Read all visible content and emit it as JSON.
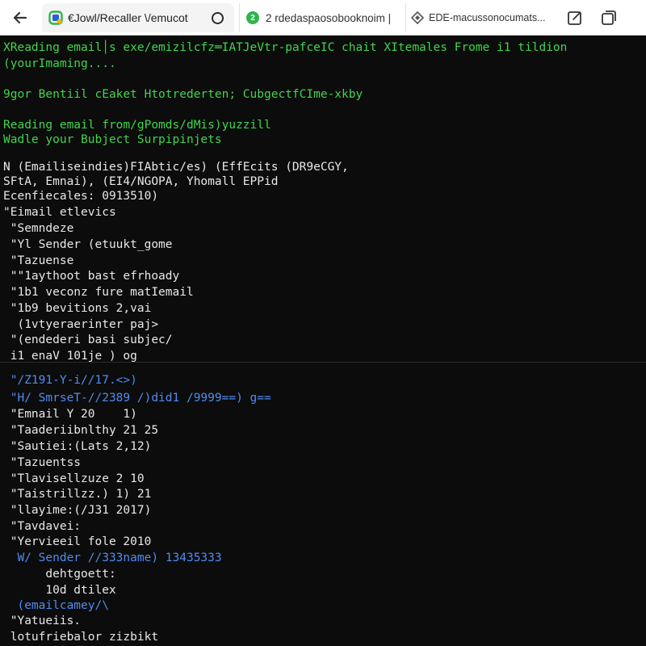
{
  "browser": {
    "tabs": [
      {
        "title": "€Jowl/Recaller \\/emucot",
        "icon": "app-favicon-icon",
        "active": true
      },
      {
        "badge": "2",
        "title": "2 rdedaspaosobooknoim |",
        "icon": "green-badge-icon"
      },
      {
        "title": "EDE-macussonocumats...",
        "icon": "puzzle-icon"
      }
    ],
    "accent": "#2fb34a"
  },
  "terminal": {
    "colors": {
      "green": "#3fd64c",
      "white": "#e8e8e8",
      "blue": "#4f8cf2",
      "background": "#0c0c0c"
    },
    "lines": [
      {
        "text": "XReading email│s exe/emizilcfz═IATJeVtr-pafceIC chait XItemales Frome i1 tildion",
        "color": "green"
      },
      {
        "text": "(yourImaming....",
        "color": "green"
      },
      {
        "text": "9gor Bentiil cEaket Htotrederten; CubgectfCIme-xkby",
        "color": "green"
      },
      {
        "text": "Reading email from/gPomds/dMis)yuzzill",
        "color": "green"
      },
      {
        "text": "Wadle your Bubject Surpipinjets",
        "color": "green"
      },
      {
        "text": "N (Emailiseindies)FIAbtic/es) (EffEcits (DR9eCGY,",
        "color": "white"
      },
      {
        "text": "SFtA, Emnai), (EI4/NGOPA, Yhomall EPPid",
        "color": "white"
      },
      {
        "text": "Ecenfiecales: 0913510)",
        "color": "white"
      },
      {
        "text": "\"Eimail etlevics",
        "color": "white"
      },
      {
        "text": " \"Semndeze",
        "color": "white"
      },
      {
        "text": " \"Yl Sender (etuukt_gome",
        "color": "white"
      },
      {
        "text": " \"Tazuense",
        "color": "white"
      },
      {
        "text": " \"\"1aythoot bast efrhoady",
        "color": "white"
      },
      {
        "text": " \"1b1 veconz fure matIemail",
        "color": "white"
      },
      {
        "text": " \"1b9 bevitions 2,vai",
        "color": "white"
      },
      {
        "text": "  (1vtyeraerinter paj>",
        "color": "white"
      },
      {
        "text": " \"(endederi basi subjec/",
        "color": "white"
      },
      {
        "text": " i1 enaV 101je ) og",
        "color": "white"
      },
      {
        "text": " \"/Z191-Y-i//17.<>)",
        "color": "blue"
      },
      {
        "text": " \"H/ SmrseT-//2389 /)did1 /9999==) g==",
        "color": "blue"
      },
      {
        "text": " \"Emnail Y 20    1)",
        "color": "white"
      },
      {
        "text": " \"Taaderiibnlthy 21 25",
        "color": "white"
      },
      {
        "text": " \"Sautiei:(Lats 2,12)",
        "color": "white"
      },
      {
        "text": " \"Tazuentss",
        "color": "white"
      },
      {
        "text": " \"Tlavisellzuze 2 10",
        "color": "white"
      },
      {
        "text": " \"Taistrillzz.) 1) 21",
        "color": "white"
      },
      {
        "text": " \"llayime:(/J31 2017)",
        "color": "white"
      },
      {
        "text": " \"Tavdavei:",
        "color": "white"
      },
      {
        "text": " \"Yervieeil fole 2010",
        "color": "white"
      },
      {
        "text": "  W/ Sender //333name) 13435333",
        "color": "blue"
      },
      {
        "text": "      dehtgoett:",
        "color": "white"
      },
      {
        "text": "      10d dtilex",
        "color": "white"
      },
      {
        "text": "  (emailcamey/\\",
        "color": "blue"
      },
      {
        "text": " \"Yatueiis.",
        "color": "white"
      },
      {
        "text": " lotufriebalor zizbikt",
        "color": "white"
      }
    ]
  }
}
